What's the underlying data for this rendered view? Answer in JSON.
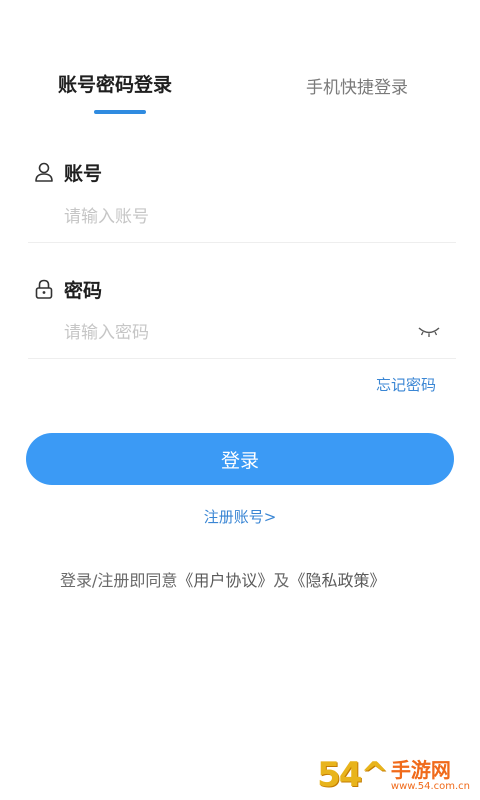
{
  "tabs": {
    "active": "账号密码登录",
    "inactive": "手机快捷登录"
  },
  "account": {
    "label": "账号",
    "placeholder": "请输入账号",
    "icon": "user-icon"
  },
  "password": {
    "label": "密码",
    "placeholder": "请输入密码",
    "icon": "lock-icon",
    "toggle_icon": "eye-closed-icon"
  },
  "forgot_password": "忘记密码",
  "login_button": "登录",
  "register_link": "注册账号>",
  "agreement": {
    "prefix": "登录/注册即同意",
    "user_agreement": "《用户协议》",
    "and": "及",
    "privacy_policy": "《隐私政策》"
  },
  "watermark": {
    "number": "54^",
    "text": "手游网",
    "url": "www.54.com.cn"
  },
  "colors": {
    "accent": "#3b9af5",
    "link": "#3a86d4",
    "tab_underline": "#2f8be0"
  }
}
